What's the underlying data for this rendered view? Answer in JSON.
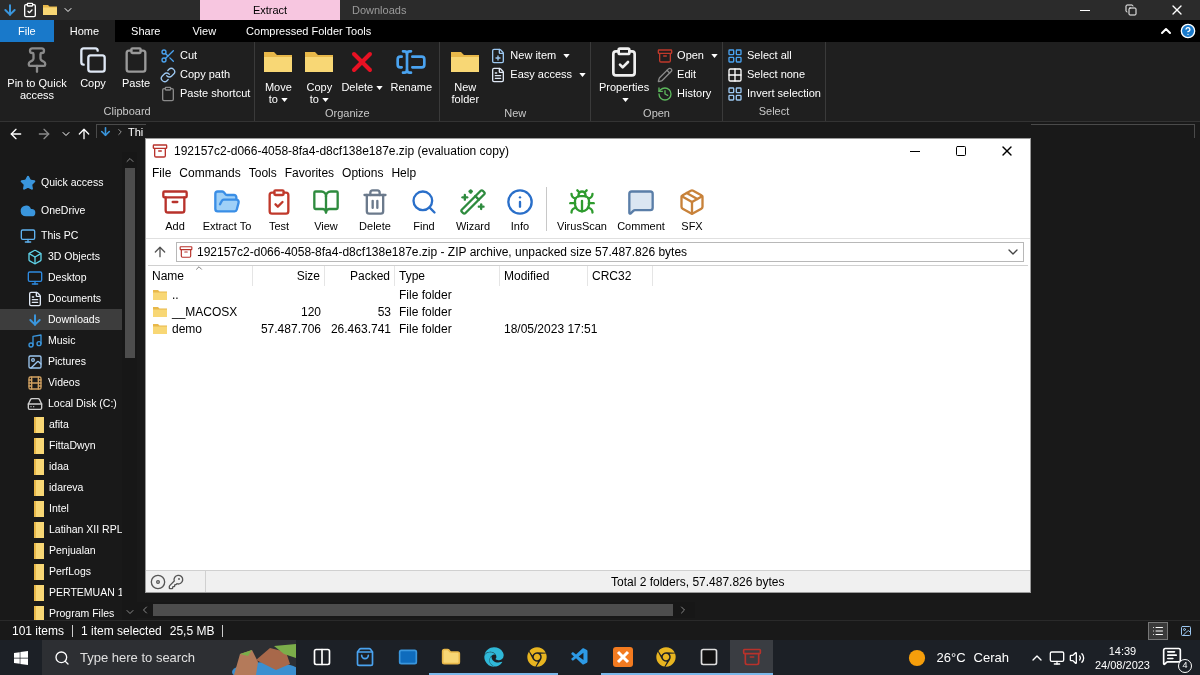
{
  "explorer": {
    "title_bar": {
      "context_tab": "Extract",
      "title": "Downloads"
    },
    "ribbon_tabs": [
      {
        "label": "File",
        "kind": "file",
        "selected": false
      },
      {
        "label": "Home",
        "kind": "tab",
        "selected": true
      },
      {
        "label": "Share",
        "kind": "tab",
        "selected": false
      },
      {
        "label": "View",
        "kind": "tab",
        "selected": false
      },
      {
        "label": "Compressed Folder Tools",
        "kind": "tab",
        "selected": false
      }
    ],
    "ribbon_groups": [
      {
        "label": "Clipboard",
        "large": [
          {
            "label": "Pin to Quick access",
            "dropdown": false
          },
          {
            "label": "Copy",
            "dropdown": false
          },
          {
            "label": "Paste",
            "dropdown": false
          }
        ],
        "small": [
          {
            "label": "Cut",
            "dropdown": false
          },
          {
            "label": "Copy path",
            "dropdown": false
          },
          {
            "label": "Paste shortcut",
            "dropdown": false
          }
        ]
      },
      {
        "label": "Organize",
        "large": [
          {
            "label": "Move to",
            "dropdown": true
          },
          {
            "label": "Copy to",
            "dropdown": true
          },
          {
            "label": "Delete",
            "dropdown": true
          },
          {
            "label": "Rename",
            "dropdown": false
          }
        ]
      },
      {
        "label": "New",
        "large": [
          {
            "label": "New folder",
            "dropdown": false
          }
        ],
        "small": [
          {
            "label": "New item",
            "dropdown": true
          },
          {
            "label": "Easy access",
            "dropdown": true
          }
        ]
      },
      {
        "label": "Open",
        "large": [
          {
            "label": "Properties",
            "dropdown": true
          }
        ],
        "small": [
          {
            "label": "Open",
            "dropdown": true
          },
          {
            "label": "Edit",
            "dropdown": false
          },
          {
            "label": "History",
            "dropdown": false
          }
        ]
      },
      {
        "label": "Select",
        "small": [
          {
            "label": "Select all",
            "dropdown": false
          },
          {
            "label": "Select none",
            "dropdown": false
          },
          {
            "label": "Invert selection",
            "dropdown": false
          }
        ]
      }
    ],
    "address": {
      "crumb": "Thi"
    },
    "nav": [
      {
        "label": "Quick access",
        "selected": false
      },
      {
        "label": "OneDrive",
        "selected": false
      },
      {
        "label": "This PC",
        "selected": false,
        "children": [
          {
            "label": "3D Objects",
            "selected": false
          },
          {
            "label": "Desktop",
            "selected": false
          },
          {
            "label": "Documents",
            "selected": false
          },
          {
            "label": "Downloads",
            "selected": true
          },
          {
            "label": "Music",
            "selected": false
          },
          {
            "label": "Pictures",
            "selected": false
          },
          {
            "label": "Videos",
            "selected": false
          },
          {
            "label": "Local Disk (C:)",
            "selected": false,
            "children": [
              {
                "label": "afita",
                "selected": false
              },
              {
                "label": "FittaDwyn",
                "selected": false
              },
              {
                "label": "idaa",
                "selected": false
              },
              {
                "label": "idareva",
                "selected": false
              },
              {
                "label": "Intel",
                "selected": false
              },
              {
                "label": "Latihan XII RPL",
                "selected": false
              },
              {
                "label": "Penjualan",
                "selected": false
              },
              {
                "label": "PerfLogs",
                "selected": false
              },
              {
                "label": "PERTEMUAN 1",
                "selected": false
              },
              {
                "label": "Program Files",
                "selected": false
              }
            ]
          }
        ]
      }
    ],
    "status": {
      "items": "101 items",
      "selection": "1 item selected",
      "size": "25,5 MB"
    }
  },
  "winrar": {
    "title": "192157c2-d066-4058-8fa4-d8cf138e187e.zip (evaluation copy)",
    "menu": [
      "File",
      "Commands",
      "Tools",
      "Favorites",
      "Options",
      "Help"
    ],
    "toolbar": [
      [
        "Add",
        "Extract To",
        "Test",
        "View",
        "Delete",
        "Find",
        "Wizard",
        "Info"
      ],
      [
        "VirusScan",
        "Comment",
        "SFX"
      ]
    ],
    "path": "192157c2-d066-4058-8fa4-d8cf138e187e.zip - ZIP archive, unpacked size 57.487.826 bytes",
    "columns": [
      {
        "label": "Name",
        "sorted": true
      },
      {
        "label": "Size",
        "sorted": false
      },
      {
        "label": "Packed",
        "sorted": false
      },
      {
        "label": "Type",
        "sorted": false
      },
      {
        "label": "Modified",
        "sorted": false
      },
      {
        "label": "CRC32",
        "sorted": false
      }
    ],
    "rows": [
      {
        "name": "..",
        "type": "File folder"
      },
      {
        "name": "__MACOSX",
        "size": "120",
        "packed": "53",
        "type": "File folder"
      },
      {
        "name": "demo",
        "size": "57.487.706",
        "packed": "26.463.741",
        "type": "File folder",
        "modified": "18/05/2023 17:51"
      }
    ],
    "status": "Total 2 folders, 57.487.826 bytes"
  },
  "taskbar": {
    "search_placeholder": "Type here to search",
    "apps": [
      {
        "running": false,
        "selected": false
      },
      {
        "running": false,
        "selected": false
      },
      {
        "running": false,
        "selected": false
      },
      {
        "running": true,
        "selected": false
      },
      {
        "running": true,
        "selected": false
      },
      {
        "running": true,
        "selected": false
      },
      {
        "running": false,
        "selected": false
      },
      {
        "running": true,
        "selected": false
      },
      {
        "running": true,
        "selected": false
      },
      {
        "running": true,
        "selected": false
      },
      {
        "running": true,
        "selected": true
      }
    ],
    "temperature": "26°C",
    "weather": "Cerah",
    "time": "14:39",
    "date": "24/08/2023",
    "notifications": "4"
  }
}
